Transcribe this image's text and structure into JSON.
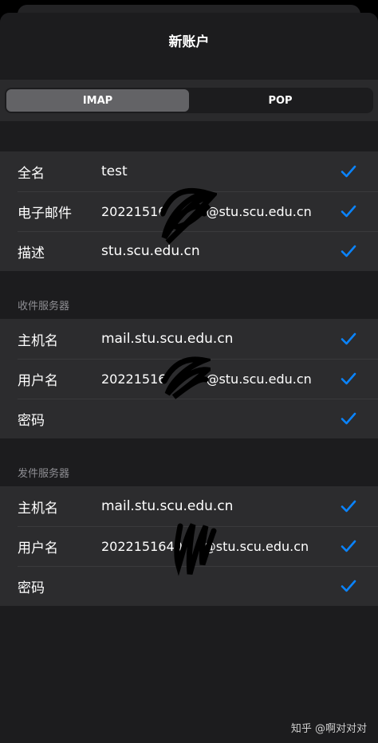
{
  "nav": {
    "title": "新账户"
  },
  "segments": {
    "imap": "IMAP",
    "pop": "POP",
    "selected": "IMAP"
  },
  "account": {
    "rows": [
      {
        "label": "全名",
        "value": "test"
      },
      {
        "label": "电子邮件",
        "value": "20221516",
        "suffix": "@stu.scu.edu.cn"
      },
      {
        "label": "描述",
        "value": "stu.scu.edu.cn"
      }
    ]
  },
  "incoming": {
    "header": "收件服务器",
    "rows": [
      {
        "label": "主机名",
        "value": "mail.stu.scu.edu.cn"
      },
      {
        "label": "用户名",
        "value": "20221516",
        "suffix": "@stu.scu.edu.cn"
      },
      {
        "label": "密码",
        "value": ""
      }
    ]
  },
  "outgoing": {
    "header": "发件服务器",
    "rows": [
      {
        "label": "主机名",
        "value": "mail.stu.scu.edu.cn"
      },
      {
        "label": "用户名",
        "value": "2022151640",
        "suffix": "@stu.scu.edu.cn"
      },
      {
        "label": "密码",
        "value": ""
      }
    ]
  },
  "watermark": "知乎 @啊对对对",
  "colors": {
    "accent": "#0a84ff",
    "background": "#1c1c1e",
    "cell": "#2c2c2e",
    "segment_active": "#636366"
  }
}
